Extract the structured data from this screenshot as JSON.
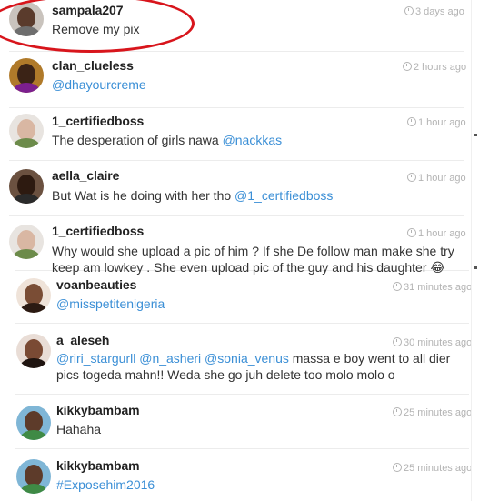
{
  "comments": [
    {
      "username": "sampala207",
      "time": "3 days ago",
      "segments": [
        {
          "text": "Remove my pix",
          "type": "plain"
        }
      ],
      "avatar": {
        "bg": "#c9c3bd",
        "skin": "#5a3b2c",
        "body": "#6e6e6e"
      }
    },
    {
      "username": "clan_clueless",
      "time": "2 hours ago",
      "segments": [
        {
          "text": "@dhayourcreme",
          "type": "mention"
        }
      ],
      "avatar": {
        "bg": "#b07a2a",
        "skin": "#3b2316",
        "body": "#7c1f8e"
      }
    },
    {
      "username": "1_certifiedboss",
      "time": "1 hour ago",
      "segments": [
        {
          "text": "The desperation of girls nawa ",
          "type": "plain"
        },
        {
          "text": "@nackkas",
          "type": "mention"
        }
      ],
      "avatar": {
        "bg": "#e8e4e0",
        "skin": "#d9b7a3",
        "body": "#6c8b4a"
      }
    },
    {
      "username": "aella_claire",
      "time": "1 hour ago",
      "segments": [
        {
          "text": "But Wat is he doing with her tho ",
          "type": "plain"
        },
        {
          "text": "@1_certifiedboss",
          "type": "mention"
        }
      ],
      "avatar": {
        "bg": "#6b5140",
        "skin": "#2d1a10",
        "body": "#2a2a2a"
      }
    },
    {
      "username": "1_certifiedboss",
      "time": "1 hour ago",
      "segments": [
        {
          "text": "Why would she upload a pic of him ? If she De follow man make she try keep am lowkey . She even upload pic of the guy and his daughter 😂",
          "type": "plain"
        }
      ],
      "avatar": {
        "bg": "#e8e4e0",
        "skin": "#d9b7a3",
        "body": "#6c8b4a"
      }
    },
    {
      "username": "voanbeauties",
      "time": "31 minutes ago",
      "segments": [
        {
          "text": "@misspetitenigeria",
          "type": "mention"
        }
      ],
      "avatar": {
        "bg": "#efe3d9",
        "skin": "#7a4d35",
        "body": "#2b1a12"
      }
    },
    {
      "username": "a_aleseh",
      "time": "30 minutes ago",
      "segments": [
        {
          "text": "@riri_stargurll",
          "type": "mention"
        },
        {
          "text": " ",
          "type": "plain"
        },
        {
          "text": "@n_asheri",
          "type": "mention"
        },
        {
          "text": " ",
          "type": "plain"
        },
        {
          "text": "@sonia_venus",
          "type": "mention"
        },
        {
          "text": " massa e boy went to all dier pics togeda mahn!! Weda she go juh delete too molo molo o",
          "type": "plain"
        }
      ],
      "avatar": {
        "bg": "#e9ddd6",
        "skin": "#7a4a34",
        "body": "#1f1410"
      }
    },
    {
      "username": "kikkybambam",
      "time": "25 minutes ago",
      "segments": [
        {
          "text": "Hahaha",
          "type": "plain"
        }
      ],
      "avatar": {
        "bg": "#7fb6d6",
        "skin": "#5d3b2a",
        "body": "#3f8a45"
      }
    },
    {
      "username": "kikkybambam",
      "time": "25 minutes ago",
      "segments": [
        {
          "text": "#Exposehim2016",
          "type": "mention"
        }
      ],
      "avatar": {
        "bg": "#7fb6d6",
        "skin": "#5d3b2a",
        "body": "#3f8a45"
      }
    }
  ]
}
